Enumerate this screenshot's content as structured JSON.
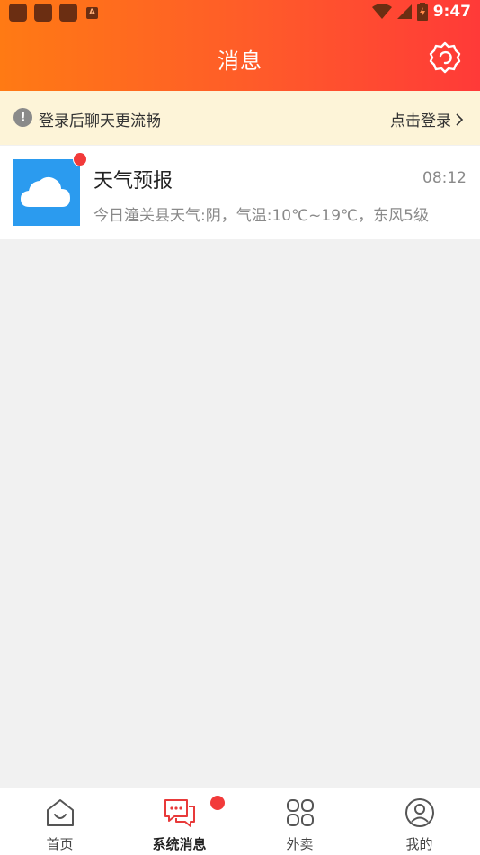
{
  "status_bar": {
    "time": "9:47",
    "notif_letter": "A"
  },
  "header": {
    "title": "消息",
    "settings_icon": "gear-icon"
  },
  "login_banner": {
    "tip": "登录后聊天更流畅",
    "link": "点击登录",
    "info_glyph": "!"
  },
  "messages": [
    {
      "title": "天气预报",
      "time": "08:12",
      "preview": "今日潼关县天气:阴，气温:10℃~19℃，东风5级",
      "icon": "cloud-icon",
      "unread": true
    }
  ],
  "bottom_nav": {
    "items": [
      {
        "label": "首页",
        "icon": "home-icon"
      },
      {
        "label": "系统消息",
        "icon": "chat-icon",
        "active": true,
        "has_dot": true
      },
      {
        "label": "外卖",
        "icon": "grid-icon"
      },
      {
        "label": "我的",
        "icon": "user-icon"
      }
    ]
  },
  "colors": {
    "accent_start": "#ff7a14",
    "accent_end": "#ff3a38",
    "banner_bg": "#fdf4d8",
    "unread_dot": "#f23a3a",
    "weather_icon_bg": "#2b9bef"
  }
}
